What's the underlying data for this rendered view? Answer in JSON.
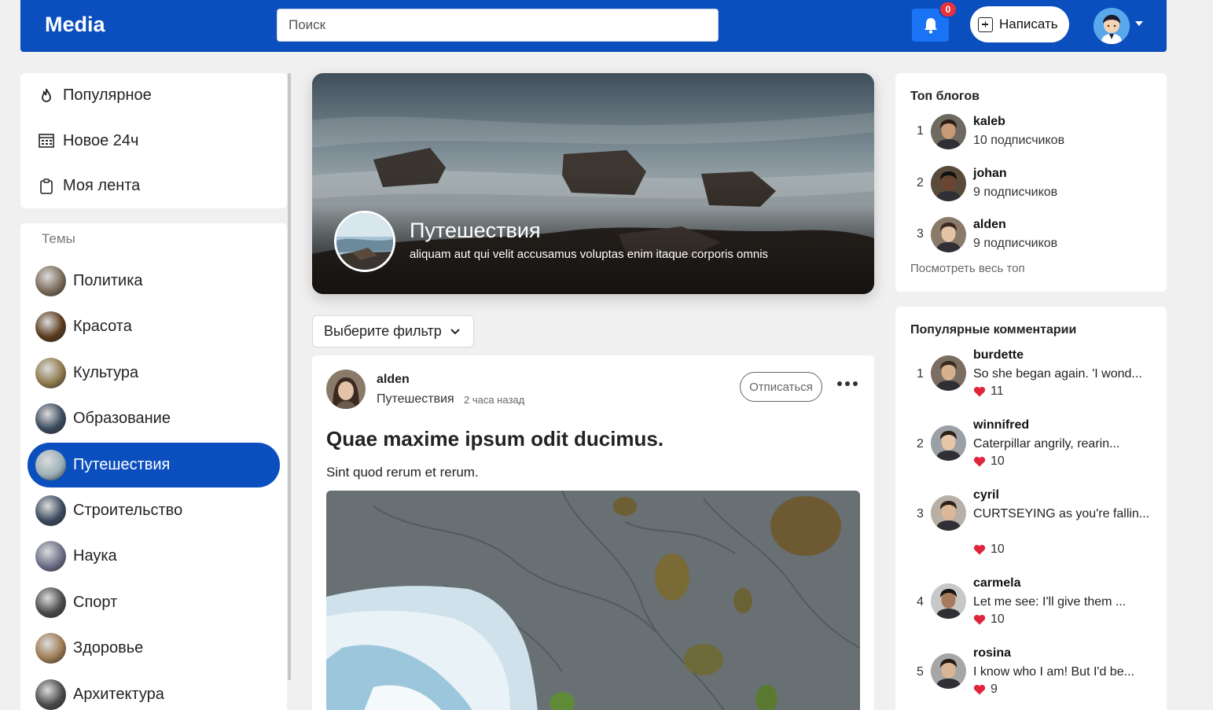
{
  "header": {
    "logo": "Media",
    "search_placeholder": "Поиск",
    "notifications_count": "0",
    "write_label": "Написать"
  },
  "nav": {
    "items": [
      {
        "label": "Популярное",
        "icon": "fire-icon"
      },
      {
        "label": "Новое 24ч",
        "icon": "calendar-icon"
      },
      {
        "label": "Моя лента",
        "icon": "clipboard-icon"
      }
    ]
  },
  "topics": {
    "title": "Темы",
    "items": [
      {
        "label": "Политика",
        "color": "#7a6a58"
      },
      {
        "label": "Красота",
        "color": "#5a3a1c"
      },
      {
        "label": "Культура",
        "color": "#8f7a4c"
      },
      {
        "label": "Образование",
        "color": "#3b4a5e"
      },
      {
        "label": "Путешествия",
        "color": "#9bb0b8",
        "active": true
      },
      {
        "label": "Строительство",
        "color": "#3b4a5e"
      },
      {
        "label": "Наука",
        "color": "#6b6e86"
      },
      {
        "label": "Спорт",
        "color": "#4a4a4a"
      },
      {
        "label": "Здоровье",
        "color": "#9c7a52"
      },
      {
        "label": "Архитектура",
        "color": "#4a4a4a"
      }
    ]
  },
  "banner": {
    "title": "Путешествия",
    "description": "aliquam aut qui velit accusamus voluptas enim itaque corporis omnis"
  },
  "filter": {
    "label": "Выберите фильтр"
  },
  "post": {
    "author": "alden",
    "topic": "Путешествия",
    "time": "2 часа назад",
    "unsubscribe_label": "Отписаться",
    "title": "Quae maxime ipsum odit ducimus.",
    "text": "Sint quod rerum et rerum."
  },
  "top_blogs": {
    "title": "Топ блогов",
    "items": [
      {
        "rank": "1",
        "name": "kaleb",
        "subs": "10 подписчиков"
      },
      {
        "rank": "2",
        "name": "johan",
        "subs": "9 подписчиков"
      },
      {
        "rank": "3",
        "name": "alden",
        "subs": "9 подписчиков"
      }
    ],
    "see_all": "Посмотреть весь топ"
  },
  "popular_comments": {
    "title": "Популярные комментарии",
    "items": [
      {
        "rank": "1",
        "name": "burdette",
        "text": "So she began again. 'I wond...",
        "likes": "11"
      },
      {
        "rank": "2",
        "name": "winnifred",
        "text": "Caterpillar angrily, rearin...",
        "likes": "10"
      },
      {
        "rank": "3",
        "name": "cyril",
        "text": "CURTSEYING as you're fallin...",
        "likes": "10"
      },
      {
        "rank": "4",
        "name": "carmela",
        "text": "Let me see: I'll give them ...",
        "likes": "10"
      },
      {
        "rank": "5",
        "name": "rosina",
        "text": "I know who I am! But I'd be...",
        "likes": "9"
      }
    ]
  }
}
